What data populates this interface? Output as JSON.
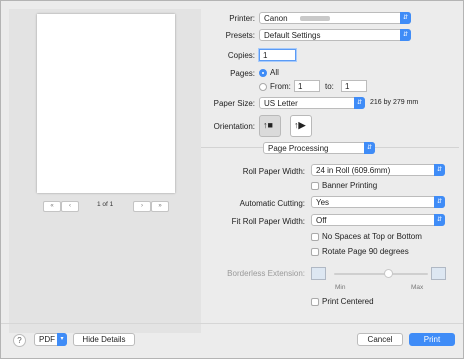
{
  "preview": {
    "page_indicator": "1 of 1",
    "first_btn": "«",
    "prev_btn": "‹",
    "next_btn": "›",
    "last_btn": "»"
  },
  "printer": {
    "label": "Printer:",
    "value": "Canon"
  },
  "presets": {
    "label": "Presets:",
    "value": "Default Settings"
  },
  "copies": {
    "label": "Copies:",
    "value": "1"
  },
  "pages": {
    "label": "Pages:",
    "all_label": "All",
    "from_label": "From:",
    "from_value": "1",
    "to_label": "to:",
    "to_value": "1"
  },
  "paper_size": {
    "label": "Paper Size:",
    "value": "US Letter",
    "dimensions": "216 by 279 mm"
  },
  "orientation": {
    "label": "Orientation:"
  },
  "section": {
    "value": "Page Processing"
  },
  "roll_paper_width": {
    "label": "Roll Paper Width:",
    "value": "24 in Roll (609.6mm)"
  },
  "banner_printing": {
    "label": "Banner Printing"
  },
  "automatic_cutting": {
    "label": "Automatic Cutting:",
    "value": "Yes"
  },
  "fit_roll_paper_width": {
    "label": "Fit Roll Paper Width:",
    "value": "Off"
  },
  "no_spaces": {
    "label": "No Spaces at Top or Bottom"
  },
  "rotate_page": {
    "label": "Rotate Page 90 degrees"
  },
  "borderless_extension": {
    "label": "Borderless Extension:",
    "min": "Min",
    "max": "Max"
  },
  "print_centered": {
    "label": "Print Centered"
  },
  "footer": {
    "help": "?",
    "pdf": "PDF",
    "hide_details": "Hide Details",
    "cancel": "Cancel",
    "print": "Print"
  },
  "colors": {
    "accent": "#3f8cf7"
  }
}
